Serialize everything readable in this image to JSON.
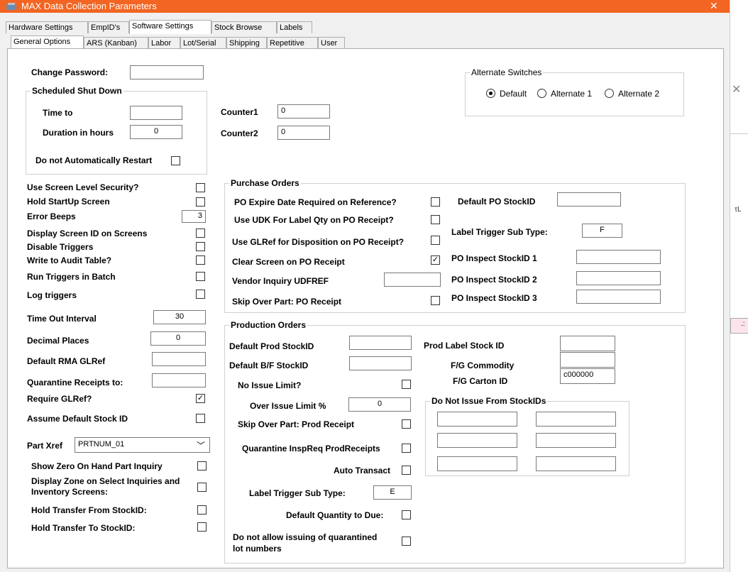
{
  "window": {
    "title": "MAX Data Collection Parameters",
    "close": "✕"
  },
  "top_tabs": [
    "Hardware Settings",
    "EmpID's",
    "Software Settings",
    "Stock Browse",
    "Labels"
  ],
  "sub_tabs": [
    "General Options",
    "ARS (Kanban)",
    "Labor",
    "Lot/Serial",
    "Shipping",
    "Repetitive",
    "User"
  ],
  "general": {
    "change_password": "Change Password:",
    "scheduled_shutdown": "Scheduled Shut Down",
    "time_to": "Time to",
    "duration": "Duration in hours",
    "duration_value": "0",
    "no_restart": "Do not Automatically  Restart",
    "counter1": "Counter1",
    "counter1_value": "0",
    "counter2": "Counter2",
    "counter2_value": "0"
  },
  "alt_switches": {
    "title": "Alternate Switches",
    "options": [
      "Default",
      "Alternate 1",
      "Alternate 2"
    ]
  },
  "left": {
    "use_screen_security": "Use Screen Level Security?",
    "hold_startup": "Hold StartUp Screen",
    "error_beeps": "Error Beeps",
    "error_beeps_value": "3",
    "display_screen_id": "Display Screen ID on Screens",
    "disable_triggers": "Disable Triggers",
    "write_audit": "Write to Audit Table?",
    "run_triggers_batch": "Run Triggers in Batch",
    "log_triggers": "Log triggers",
    "timeout": "Time Out Interval",
    "timeout_value": "30",
    "decimal_places": "Decimal Places",
    "decimal_places_value": "0",
    "default_rma": "Default RMA GLRef",
    "quarantine_receipts": "Quarantine Receipts to:",
    "require_glref": "Require GLRef?",
    "assume_default_stock": "Assume Default Stock ID",
    "part_xref": "Part Xref",
    "part_xref_value": "PRTNUM_01",
    "show_zero_onhand": "Show Zero On Hand Part Inquiry",
    "display_zone_1": "Display Zone on Select Inquiries and",
    "display_zone_2": "Inventory Screens:",
    "hold_transfer_from": "Hold Transfer From StockID:",
    "hold_transfer_to": "Hold Transfer To StockID:"
  },
  "purchase_orders": {
    "title": "Purchase Orders",
    "expire_date": "PO Expire Date Required on Reference?",
    "udk_label": "Use UDK For Label Qty on PO Receipt?",
    "glref_disposition": "Use GLRef for Disposition on PO Receipt?",
    "clear_screen": "Clear Screen on PO Receipt",
    "vendor_inquiry": "Vendor Inquiry UDFREF",
    "skip_over": "Skip Over Part: PO Receipt",
    "default_po_stock": "Default PO StockID",
    "label_trigger": "Label Trigger Sub Type:",
    "label_trigger_value": "F",
    "inspect1": "PO Inspect StockID 1",
    "inspect2": "PO Inspect StockID 2",
    "inspect3": "PO Inspect StockID 3"
  },
  "production_orders": {
    "title": "Production Orders",
    "default_prod_stock": "Default Prod StockID",
    "default_bf_stock": "Default B/F StockID",
    "no_issue_limit": "No Issue Limit?",
    "over_issue": "Over Issue Limit %",
    "over_issue_value": "0",
    "skip_over": "Skip Over Part: Prod Receipt",
    "quarantine_insp": "Quarantine InspReq ProdReceipts",
    "auto_transact": "Auto Transact",
    "label_trigger": "Label Trigger Sub Type:",
    "label_trigger_value": "E",
    "default_qty_due": "Default Quantity to Due:",
    "no_quarantined_1": "Do not allow issuing of quarantined",
    "no_quarantined_2": "lot numbers",
    "prod_label_stock": "Prod Label Stock ID",
    "fg_commodity": "F/G Commodity",
    "fg_carton": "F/G Carton ID",
    "fg_carton_value": "c000000",
    "do_not_issue": "Do Not Issue From StockIDs"
  },
  "check_mark": "✓"
}
